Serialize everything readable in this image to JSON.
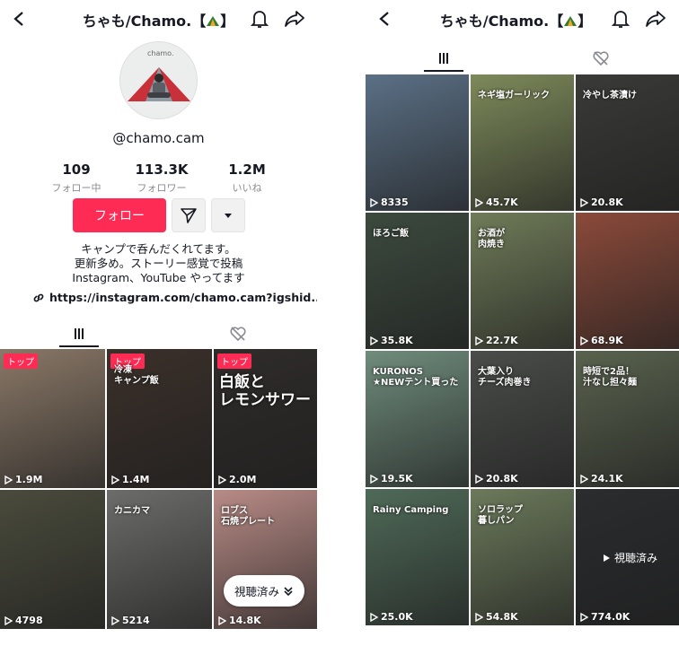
{
  "profile": {
    "title": "ちゃも/Chamo.【",
    "title_end": "】",
    "username": "@chamo.cam",
    "stats": [
      {
        "value": "109",
        "label": "フォロー中"
      },
      {
        "value": "113.3K",
        "label": "フォロワー"
      },
      {
        "value": "1.2M",
        "label": "いいね"
      }
    ],
    "follow_label": "フォロー",
    "bio_lines": [
      "キャンプで呑んだくれてます。",
      "更新多め。ストーリー感覚で投稿",
      "Instagram、YouTube やってます"
    ],
    "link": "https://instagram.com/chamo.cam?igshid...",
    "avatar_text": "chamo."
  },
  "left_grid": [
    {
      "views": "1.9M",
      "badge": "トップ",
      "bg": "#8a7867"
    },
    {
      "views": "1.4M",
      "badge": "トップ",
      "bg": "#3b302a",
      "overlay": "冷凍\nキャンプ飯"
    },
    {
      "views": "2.0M",
      "badge": "トップ",
      "bg": "#2f2c2a",
      "overlay": "白飯と\nレモンサワー"
    },
    {
      "views": "4798",
      "bg": "#4a4b3c"
    },
    {
      "views": "5214",
      "bg": "#6c6d6a",
      "overlay": "カニカマ"
    },
    {
      "views": "14.8K",
      "bg": "#b88b86",
      "overlay": "ロブス\n石焼プレート"
    }
  ],
  "watched_pill": "視聴済み",
  "right_title": "ちゃも/Chamo.【",
  "right_grid": [
    {
      "views": "8335",
      "bg": "#5b7086"
    },
    {
      "views": "45.7K",
      "bg": "#7d8a5a",
      "overlay": "ネギ塩ガーリック"
    },
    {
      "views": "20.8K",
      "bg": "#3a3a38",
      "overlay": "冷やし茶漬け"
    },
    {
      "views": "35.8K",
      "bg": "#3c4a3e",
      "overlay": "ほろご飯"
    },
    {
      "views": "22.7K",
      "bg": "#6f7b58",
      "overlay": "お酒が\n肉焼き"
    },
    {
      "views": "68.9K",
      "bg": "#8b4a3a"
    },
    {
      "views": "19.5K",
      "bg": "#6f8c7c",
      "overlay": "KURONOS\n★NEWテント買った"
    },
    {
      "views": "20.8K",
      "bg": "#4a4d4a",
      "overlay": "大葉入り\nチーズ肉巻き"
    },
    {
      "views": "24.1K",
      "bg": "#59624e",
      "overlay": "時短で2品！\n汁なし担々麺"
    },
    {
      "views": "25.0K",
      "bg": "#4f6a58",
      "overlay": "Rainy Camping"
    },
    {
      "views": "54.8K",
      "bg": "#6c7a5b",
      "overlay": "ソロラップ\n暮しパン"
    },
    {
      "views": "774.0K",
      "bg": "#2a2c2e"
    }
  ],
  "right_watched": "視聴済み",
  "colors": {
    "accent": "#fe2c55",
    "text": "#161823",
    "muted": "#8a8b91"
  }
}
